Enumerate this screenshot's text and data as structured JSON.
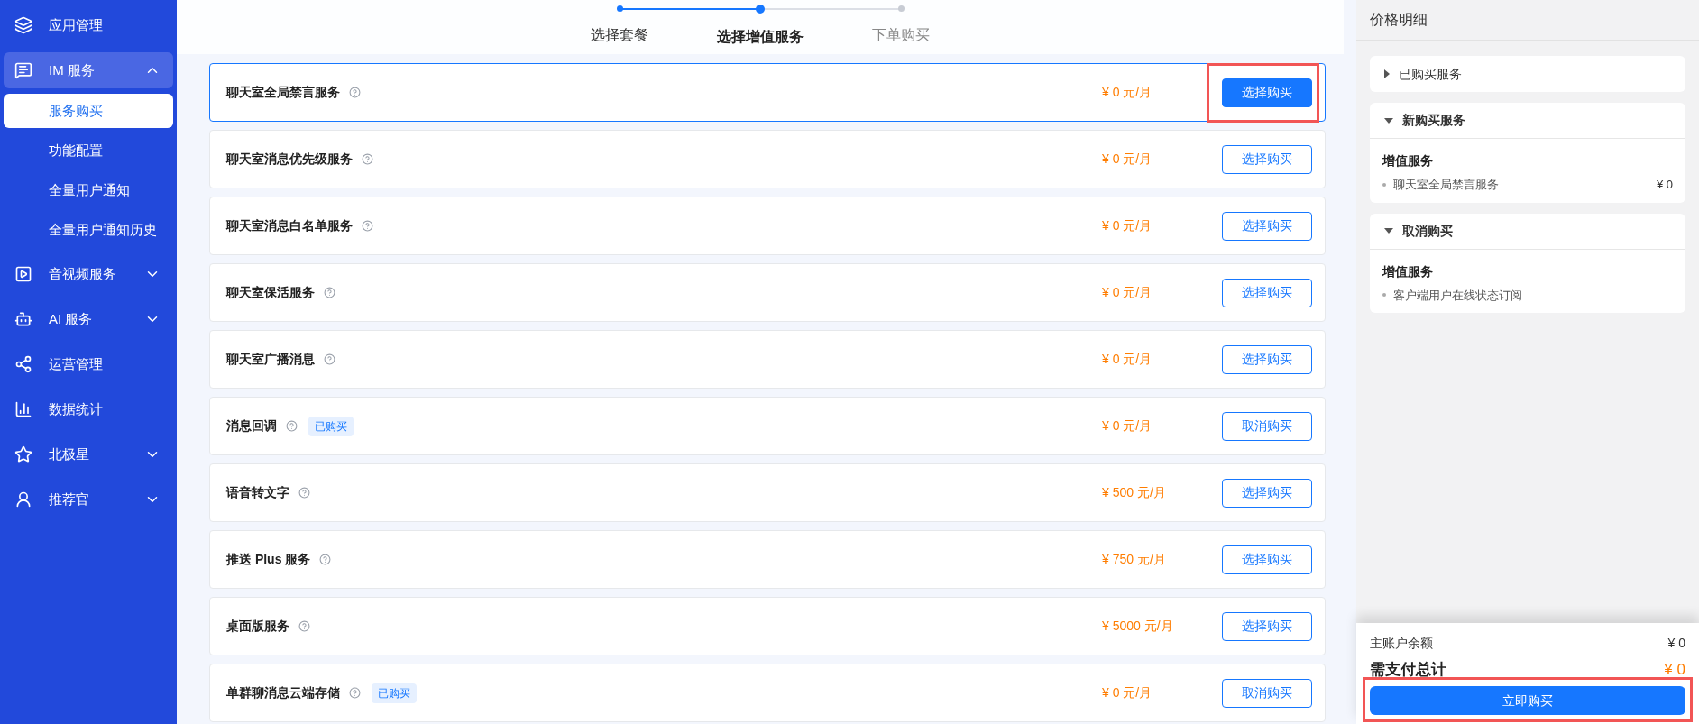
{
  "sidebar": {
    "items": [
      {
        "label": "应用管理",
        "selected": false
      },
      {
        "label": "IM 服务",
        "selected": true,
        "expanded": true,
        "children": [
          {
            "label": "服务购买",
            "selected": true
          },
          {
            "label": "功能配置",
            "selected": false
          },
          {
            "label": "全量用户通知",
            "selected": false
          },
          {
            "label": "全量用户通知历史",
            "selected": false
          }
        ]
      },
      {
        "label": "音视频服务",
        "selected": false,
        "expanded": false
      },
      {
        "label": "AI 服务",
        "selected": false,
        "expanded": false
      },
      {
        "label": "运营管理",
        "selected": false
      },
      {
        "label": "数据统计",
        "selected": false
      },
      {
        "label": "北极星",
        "selected": false,
        "expanded": false
      },
      {
        "label": "推荐官",
        "selected": false,
        "expanded": false
      }
    ]
  },
  "steps": [
    {
      "label": "选择套餐",
      "done": true,
      "selected": false
    },
    {
      "label": "选择增值服务",
      "done": true,
      "selected": true
    },
    {
      "label": "下单购买",
      "done": false,
      "selected": false
    }
  ],
  "services": [
    {
      "name": "聊天室全局禁言服务",
      "price": "¥ 0 元/月",
      "button": "选择购买",
      "kind": "select",
      "selected": true,
      "annotated": true
    },
    {
      "name": "聊天室消息优先级服务",
      "price": "¥ 0 元/月",
      "button": "选择购买",
      "kind": "select",
      "selected": false,
      "annotated": false
    },
    {
      "name": "聊天室消息白名单服务",
      "price": "¥ 0 元/月",
      "button": "选择购买",
      "kind": "select",
      "selected": false,
      "annotated": false
    },
    {
      "name": "聊天室保活服务",
      "price": "¥ 0 元/月",
      "button": "选择购买",
      "kind": "select",
      "selected": false,
      "annotated": false
    },
    {
      "name": "聊天室广播消息",
      "price": "¥ 0 元/月",
      "button": "选择购买",
      "kind": "select",
      "selected": false,
      "annotated": false
    },
    {
      "name": "消息回调",
      "badge": "已购买",
      "price": "¥ 0 元/月",
      "button": "取消购买",
      "kind": "cancel",
      "selected": false,
      "annotated": false
    },
    {
      "name": "语音转文字",
      "price": "¥ 500 元/月",
      "button": "选择购买",
      "kind": "select",
      "selected": false,
      "annotated": false
    },
    {
      "name": "推送 Plus 服务",
      "price": "¥ 750 元/月",
      "button": "选择购买",
      "kind": "select",
      "selected": false,
      "annotated": false
    },
    {
      "name": "桌面版服务",
      "price": "¥ 5000 元/月",
      "button": "选择购买",
      "kind": "select",
      "selected": false,
      "annotated": false
    },
    {
      "name": "单群聊消息云端存储",
      "badge": "已购买",
      "price": "¥ 0 元/月",
      "button": "取消购买",
      "kind": "cancel",
      "selected": false,
      "annotated": false
    }
  ],
  "price_panel": {
    "title": "价格明细",
    "sections": [
      {
        "title": "已购买服务",
        "expanded": false
      },
      {
        "title": "新购买服务",
        "expanded": true,
        "group": "增值服务",
        "items": [
          {
            "name": "聊天室全局禁言服务",
            "price": "¥ 0"
          }
        ]
      },
      {
        "title": "取消购买",
        "expanded": true,
        "group": "增值服务",
        "items": [
          {
            "name": "客户端用户在线状态订阅"
          }
        ]
      }
    ],
    "balance_label": "主账户余额",
    "balance": "¥ 0",
    "total_label": "需支付总计",
    "total": "¥ 0",
    "buy_button": "立即购买",
    "buy_annotated": true
  }
}
